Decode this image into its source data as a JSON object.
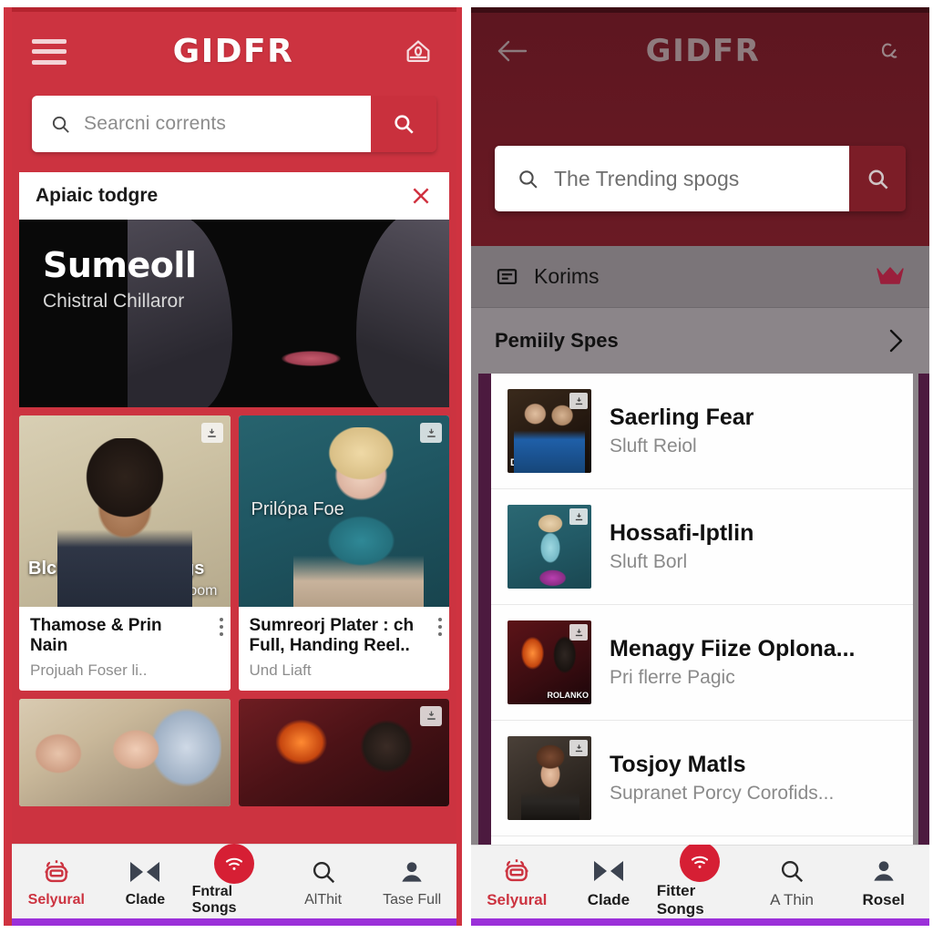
{
  "left_panel": {
    "topbar": {
      "menu_icon": "hamburger-menu-icon",
      "brand": "GIDFR",
      "right_icon": "home-shield-icon"
    },
    "search": {
      "placeholder": "Searcni corrents",
      "search_icon": "search-icon",
      "button_icon": "search-icon"
    },
    "promo": {
      "title": "Apiaic todgre",
      "close_icon": "close-icon",
      "banner_heading": "Sumeoll",
      "banner_subheading": "Chistral Chillaror"
    },
    "cards": [
      {
        "overlay_title": "BlcBosing Cevvings",
        "overlay_sub": "a Boom",
        "overlay_center": "",
        "title": "Thamose & Prin Nain",
        "subtitle": "Projuah Foser li..",
        "badge_icon": "download-icon",
        "menu_icon": "kebab-menu-icon"
      },
      {
        "overlay_title": "",
        "overlay_sub": "",
        "overlay_center": "Prilópa Foe",
        "title": "Sumreorj Plater : ch Full, Handing Reel..",
        "subtitle": "Und Liaft",
        "badge_icon": "download-icon",
        "menu_icon": "kebab-menu-icon"
      }
    ],
    "bottom_nav": [
      {
        "label": "Selyural",
        "icon": "mascot-icon",
        "state": "active"
      },
      {
        "label": "Clade",
        "icon": "bowtie-icon",
        "state": "normal"
      },
      {
        "label": "Fntral Songs",
        "icon": "wifi-fab-icon",
        "state": "normal"
      },
      {
        "label": "AlThit",
        "icon": "search-icon",
        "state": "muted"
      },
      {
        "label": "Tase Full",
        "icon": "person-icon",
        "state": "muted"
      }
    ],
    "accent_color": "#cc3340",
    "purple_bar_color": "#9b30d9"
  },
  "right_panel": {
    "topbar": {
      "back_icon": "back-arrow-icon",
      "brand": "GIDFR",
      "right_icon": "alpha-icon"
    },
    "search": {
      "value": "The Trending spogs",
      "search_icon": "search-icon",
      "button_icon": "search-icon"
    },
    "korims_row": {
      "label": "Korims",
      "left_icon": "list-card-icon",
      "right_icon": "crown-icon"
    },
    "section": {
      "title": "Pemiily Spes",
      "chevron_icon": "chevron-right-icon"
    },
    "list_items": [
      {
        "title": "Saerling Fear",
        "subtitle": "Sluft Reiol",
        "thumb_caption": "Dotor Reirus",
        "thumb_caption2": "",
        "badge_icon": "download-icon"
      },
      {
        "title": "Hossafi-Iptlin",
        "subtitle": "Sluft Borl",
        "thumb_caption": "",
        "thumb_caption2": "",
        "badge_icon": "download-icon"
      },
      {
        "title": "Menagy Fiize Oplona...",
        "subtitle": "Pri flerre Pagic",
        "thumb_caption": "",
        "thumb_caption2": "ROLANKO",
        "badge_icon": "download-icon"
      },
      {
        "title": "Tosjoy Matls",
        "subtitle": "Supranet Porcy Corofids...",
        "thumb_caption": "",
        "thumb_caption2": "",
        "badge_icon": "download-icon"
      }
    ],
    "bottom_nav": [
      {
        "label": "Selyural",
        "icon": "mascot-icon",
        "state": "active"
      },
      {
        "label": "Clade",
        "icon": "bowtie-icon",
        "state": "normal"
      },
      {
        "label": "Fitter Songs",
        "icon": "wifi-fab-icon",
        "state": "normal"
      },
      {
        "label": "A Thin",
        "icon": "search-icon",
        "state": "muted"
      },
      {
        "label": "Rosel",
        "icon": "person-icon",
        "state": "normal"
      }
    ],
    "accent_color": "#7c1d27",
    "purple_bar_color": "#9b30d9"
  }
}
